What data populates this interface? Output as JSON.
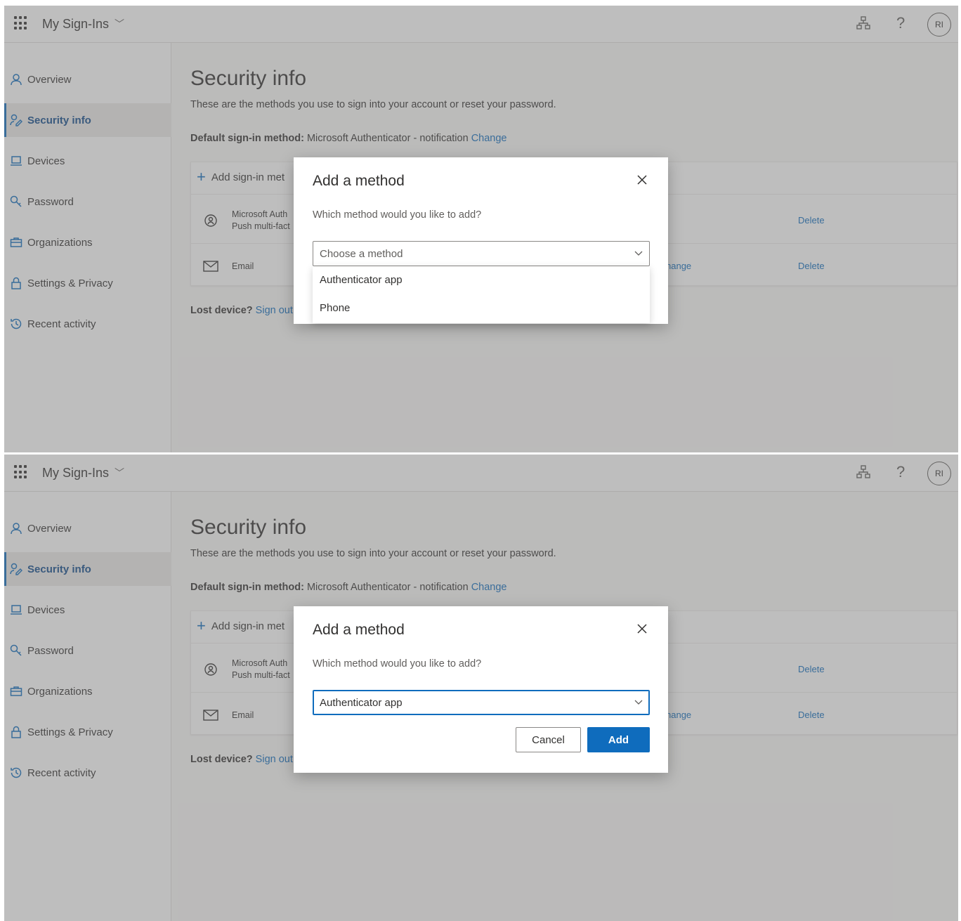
{
  "header": {
    "app_title": "My Sign-Ins",
    "avatar_initials": "RI"
  },
  "sidebar": {
    "items": [
      {
        "label": "Overview",
        "icon": "person-icon"
      },
      {
        "label": "Security info",
        "icon": "security-info-icon"
      },
      {
        "label": "Devices",
        "icon": "laptop-icon"
      },
      {
        "label": "Password",
        "icon": "key-icon"
      },
      {
        "label": "Organizations",
        "icon": "briefcase-icon"
      },
      {
        "label": "Settings & Privacy",
        "icon": "lock-icon"
      },
      {
        "label": "Recent activity",
        "icon": "history-icon"
      }
    ]
  },
  "main": {
    "title": "Security info",
    "subtitle": "These are the methods you use to sign into your account or reset your password.",
    "default_label": "Default sign-in method:",
    "default_value": "Microsoft Authenticator - notification",
    "default_change": "Change",
    "add_method": "Add sign-in met",
    "methods": [
      {
        "line1": "Microsoft Auth",
        "line2": "Push multi-fact",
        "change": "",
        "delete": "Delete"
      },
      {
        "line1": "Email",
        "line2": "",
        "change": "hange",
        "delete": "Delete"
      }
    ],
    "lost_label": "Lost device?",
    "lost_link": "Sign out"
  },
  "dialog": {
    "title": "Add a method",
    "question": "Which method would you like to add?",
    "placeholder": "Choose a method",
    "options": [
      "Authenticator app",
      "Phone"
    ],
    "selected": "Authenticator app",
    "cancel_label": "Cancel",
    "add_label": "Add"
  },
  "colors": {
    "accent": "#0f6cbd",
    "overlay": "#6e6e6e"
  }
}
